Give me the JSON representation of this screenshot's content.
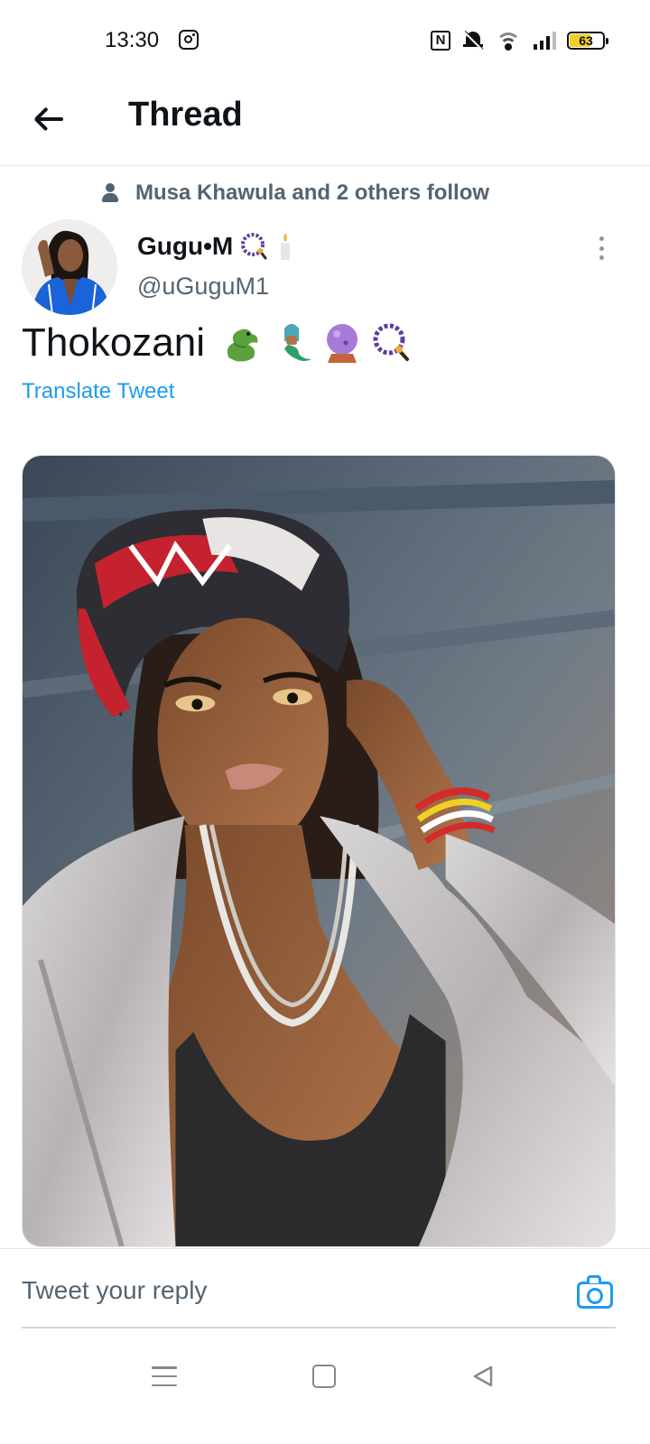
{
  "status_bar": {
    "time": "13:30",
    "battery": "63",
    "battery_level": 0.63,
    "icons": [
      "instagram-icon",
      "nfc-icon",
      "bell-muted-icon",
      "wifi-icon",
      "signal-icon",
      "battery-icon"
    ]
  },
  "header": {
    "title": "Thread",
    "back_icon": "arrow-left-icon"
  },
  "social_context": {
    "text": "Musa Khawula and 2 others follow",
    "icon": "person-icon"
  },
  "tweet": {
    "author_name": "Gugu•M",
    "author_name_emoji": [
      "prayer-beads-emoji",
      "candle-emoji"
    ],
    "handle": "@uGuguM1",
    "text": "Thokozani",
    "text_emoji": [
      "dragon-emoji",
      "mermaid-emoji",
      "crystal-ball-emoji",
      "prayer-beads-emoji"
    ],
    "translate_label": "Translate Tweet",
    "more_icon": "more-vertical-icon"
  },
  "reply": {
    "placeholder": "Tweet your reply",
    "camera_icon": "camera-icon"
  },
  "nav_bar": {
    "icons": [
      "menu-icon",
      "home-square-icon",
      "back-triangle-icon"
    ]
  },
  "colors": {
    "accent": "#1d9bf0",
    "secondary_text": "#536471",
    "primary_text": "#0f1419",
    "battery_fill": "#f2d024"
  }
}
